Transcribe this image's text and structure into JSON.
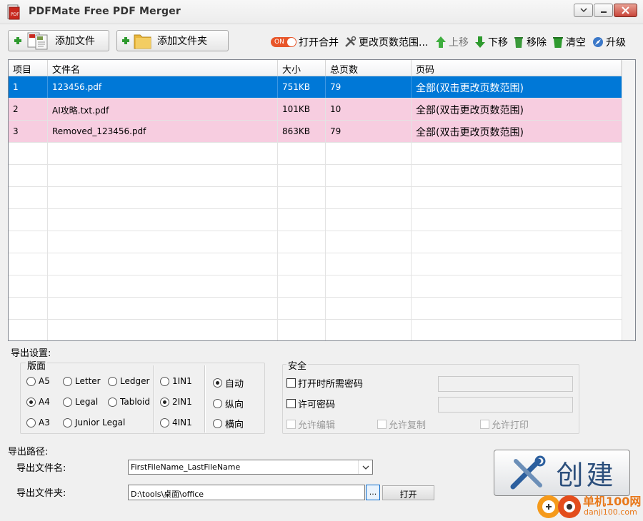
{
  "window": {
    "title": "PDFMate Free PDF Merger"
  },
  "toolbar": {
    "add_file": "添加文件",
    "add_folder": "添加文件夹",
    "toggle_state": "ON",
    "open_merge": "打开合并",
    "change_range": "更改页数范围...",
    "move_up": "上移",
    "move_down": "下移",
    "remove": "移除",
    "clear": "清空",
    "upgrade": "升级"
  },
  "table": {
    "headers": [
      "项目",
      "文件名",
      "大小",
      "总页数",
      "页码"
    ],
    "rows": [
      {
        "index": "1",
        "name": "123456.pdf",
        "size": "751KB",
        "pages": "79",
        "range": "全部(双击更改页数范围)",
        "selected": true
      },
      {
        "index": "2",
        "name": "AI攻略.txt.pdf",
        "size": "101KB",
        "pages": "10",
        "range": "全部(双击更改页数范围)",
        "selected": false
      },
      {
        "index": "3",
        "name": "Removed_123456.pdf",
        "size": "863KB",
        "pages": "79",
        "range": "全部(双击更改页数范围)",
        "selected": false
      }
    ]
  },
  "output": {
    "label": "导出设置:",
    "layout_label": "版面",
    "page_sizes": [
      {
        "label": "A5",
        "selected": false
      },
      {
        "label": "Letter",
        "selected": false
      },
      {
        "label": "Ledger",
        "selected": false
      },
      {
        "label": "A4",
        "selected": true
      },
      {
        "label": "Legal",
        "selected": false
      },
      {
        "label": "Tabloid",
        "selected": false
      },
      {
        "label": "A3",
        "selected": false
      },
      {
        "label": "Junior Legal",
        "selected": false
      }
    ],
    "nup": [
      {
        "label": "1IN1",
        "selected": false
      },
      {
        "label": "2IN1",
        "selected": true
      },
      {
        "label": "4IN1",
        "selected": false
      }
    ],
    "orientation": [
      {
        "label": "自动",
        "selected": true
      },
      {
        "label": "纵向",
        "selected": false
      },
      {
        "label": "横向",
        "selected": false
      }
    ]
  },
  "security": {
    "label": "安全",
    "open_password": "打开时所需密码",
    "permission_password": "许可密码",
    "allow_edit": "允许编辑",
    "allow_copy": "允许复制",
    "allow_print": "允许打印"
  },
  "path": {
    "label": "导出路径:",
    "file_name_label": "导出文件名:",
    "file_name_value": "FirstFileName_LastFileName",
    "folder_label": "导出文件夹:",
    "folder_value": "D:\\tools\\桌面\\office",
    "browse": "...",
    "open": "打开"
  },
  "create": {
    "label": "创建"
  },
  "watermark": {
    "site": "单机100网",
    "url": "danji100.com"
  },
  "colors": {
    "selected_row": "#0078d7",
    "pink_row": "#f7cde0",
    "accent_green": "#2e9a2e",
    "toggle": "#e8562a"
  }
}
